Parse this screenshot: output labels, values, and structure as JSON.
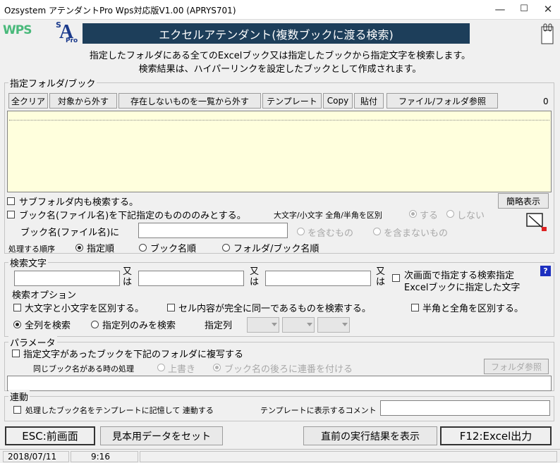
{
  "window": {
    "title": "Ozsystem アテンダントPro Wps対応版V1.00 (APRYS701)",
    "controls": {
      "minimize": "—",
      "maximize": "☐",
      "close": "✕"
    }
  },
  "logos": {
    "wps": "WPS",
    "sap_s": "S",
    "sap_a": "A",
    "sap_pro": "Pro"
  },
  "banner": {
    "title": "エクセルアテンダント(複数ブックに渡る検索)"
  },
  "description": {
    "line1": "指定したフォルダにある全てのExcelブック又は指定したブックから指定文字を検索します。",
    "line2": "検索結果は、ハイパーリンクを設定したブックとして作成されます。"
  },
  "folder_section": {
    "label": "指定フォルダ/ブック",
    "toolbar": {
      "clear_all": "全クリア",
      "remove_target": "対象から外す",
      "remove_missing": "存在しないものを一覧から外す",
      "template": "テンプレート",
      "copy": "Copy",
      "paste": "貼付",
      "browse": "ファイル/フォルダ参照"
    },
    "count": "0",
    "include_subfolders": "サブフォルダ内も検索する。",
    "simple_view": "簡略表示",
    "only_named_books": "ブック名(ファイル名)を下記指定のものののみとする。",
    "case_label": "大文字/小文字 全角/半角を区別",
    "case_yes": "する",
    "case_no": "しない",
    "book_name_label": "ブック名(ファイル名)に",
    "book_name_value": "",
    "contains": "を含むもの",
    "not_contains": "を含まないもの",
    "order_label": "処理する順序",
    "order_specified": "指定順",
    "order_bookname": "ブック名順",
    "order_folder_book": "フォルダ/ブック名順"
  },
  "search_section": {
    "label": "検索文字",
    "term1": "",
    "term2": "",
    "term3": "",
    "or1": "又は",
    "or2": "又は",
    "or3": "又は",
    "next_screen_l1": "次画面で指定する検索指定",
    "next_screen_l2": "Excelブックに指定した文字",
    "help": "?",
    "options_label": "検索オプション",
    "case_sensitive": "大文字と小文字を区別する。",
    "exact_match": "セル内容が完全に同一であるものを検索する。",
    "width_sensitive": "半角と全角を区別する。",
    "all_columns": "全列を検索",
    "specified_columns": "指定列のみを検索",
    "column_label": "指定列"
  },
  "param_section": {
    "label": "パラメータ",
    "copy_books": "指定文字があったブックを下記のフォルダに複写する",
    "same_name_label": "同じブック名がある時の処理",
    "overwrite": "上書き",
    "append_number": "ブック名の後ろに連番を付ける",
    "folder_browse": "フォルダ参照",
    "folder_path": ""
  },
  "link_section": {
    "label": "連動",
    "remember": "処理したブック名をテンプレートに記憶して 連動する",
    "comment_label": "テンプレートに表示するコメント",
    "comment_value": ""
  },
  "footer": {
    "esc": "ESC:前画面",
    "sample": "見本用データをセット",
    "show_last": "直前の実行結果を表示",
    "f12": "F12:Excel出力"
  },
  "status": {
    "date": "2018/07/11",
    "time": "9:16"
  },
  "colors": {
    "banner": "#1d3e5a",
    "list_bg": "#ffffdd",
    "wps_logo": "#49b97b",
    "sap_blue": "#1b3a8c"
  }
}
